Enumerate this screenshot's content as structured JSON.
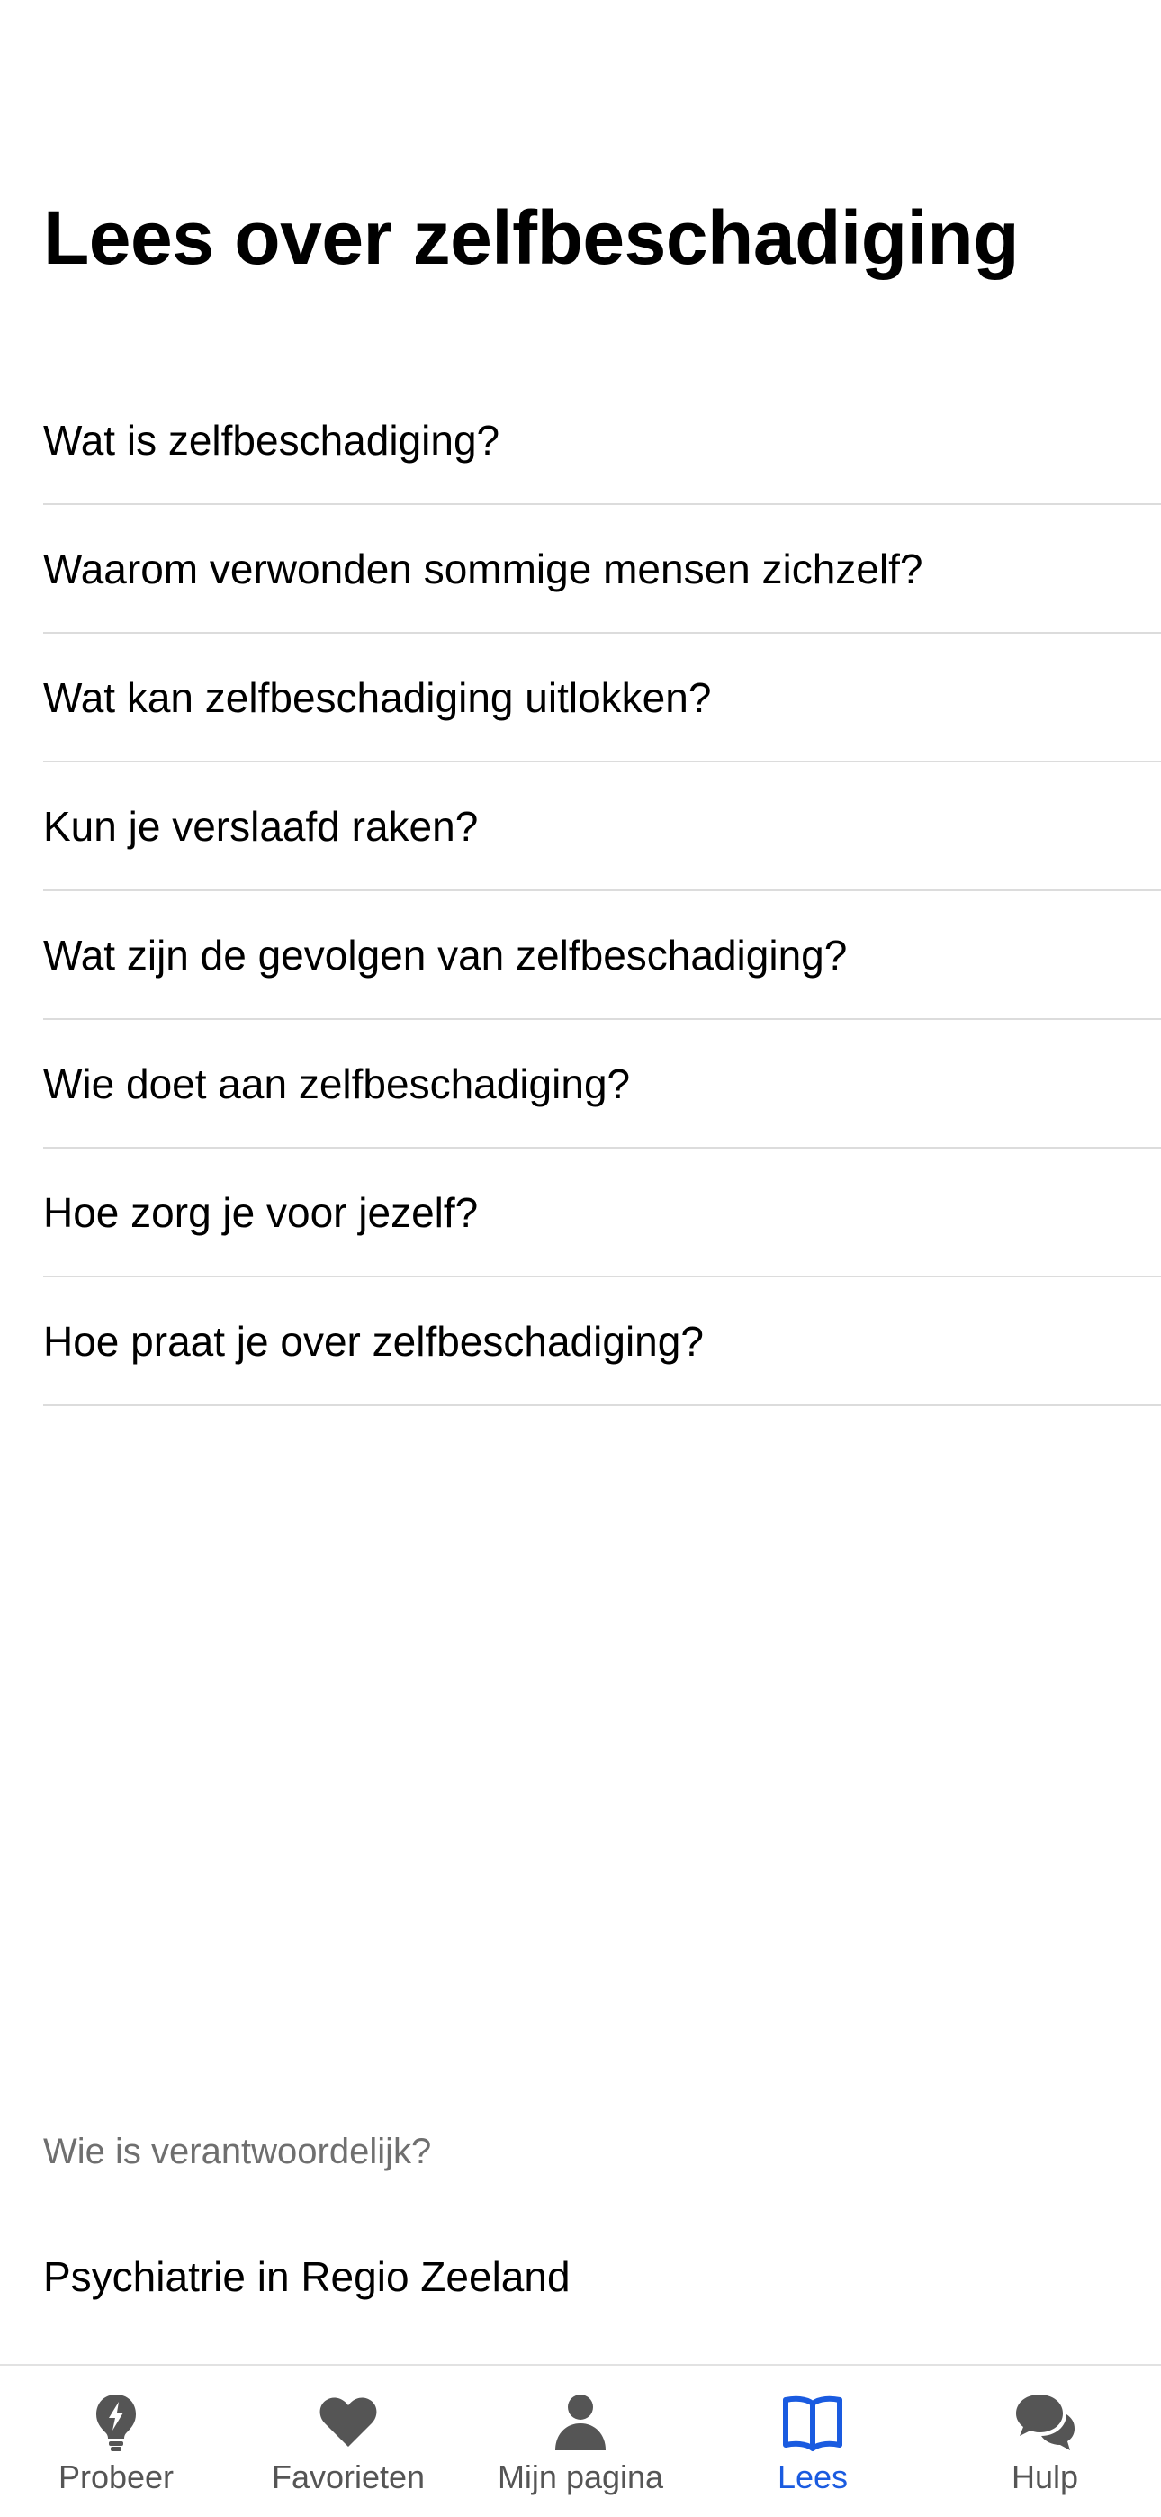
{
  "header": {
    "title": "Lees over zelfbeschadiging"
  },
  "topics": [
    {
      "label": "Wat is zelfbeschadiging?"
    },
    {
      "label": "Waarom verwonden sommige mensen zichzelf?"
    },
    {
      "label": "Wat kan zelfbeschadiging uitlokken?"
    },
    {
      "label": "Kun je verslaafd raken?"
    },
    {
      "label": "Wat zijn de gevolgen van zelfbeschadiging?"
    },
    {
      "label": "Wie doet aan zelfbeschadiging?"
    },
    {
      "label": "Hoe zorg je voor jezelf?"
    },
    {
      "label": "Hoe praat je over zelfbeschadiging?"
    }
  ],
  "responsible": {
    "label": "Wie is verantwoordelijk?",
    "organization": "Psychiatrie in Regio Zeeland"
  },
  "tabs": [
    {
      "label": "Probeer",
      "icon": "lightbulb-icon",
      "active": false
    },
    {
      "label": "Favorieten",
      "icon": "heart-icon",
      "active": false
    },
    {
      "label": "Mijn pagina",
      "icon": "person-icon",
      "active": false
    },
    {
      "label": "Lees",
      "icon": "book-icon",
      "active": true
    },
    {
      "label": "Hulp",
      "icon": "chat-bubbles-icon",
      "active": false
    }
  ],
  "colors": {
    "accent": "#1a5be0",
    "inactive_icon": "#555555",
    "divider": "#dcdcdc",
    "muted_text": "#6f6f6f"
  }
}
